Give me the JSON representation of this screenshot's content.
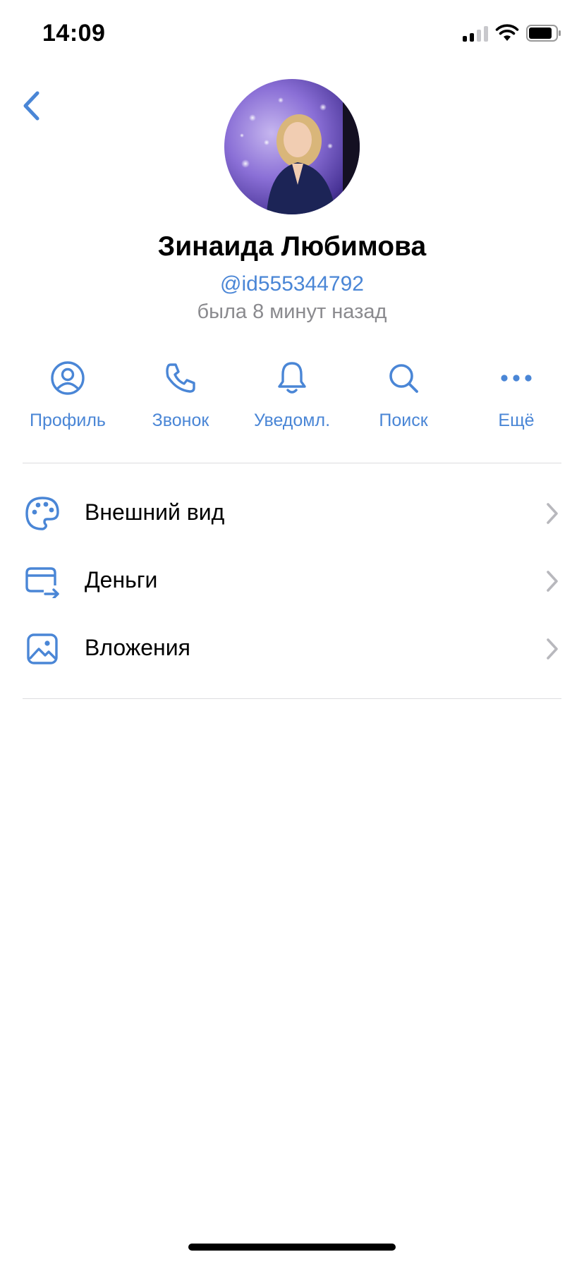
{
  "status_bar": {
    "time": "14:09"
  },
  "profile": {
    "name": "Зинаида Любимова",
    "handle": "@id555344792",
    "last_seen": "была 8 минут назад"
  },
  "actions": [
    {
      "label": "Профиль",
      "icon": "profile-icon"
    },
    {
      "label": "Звонок",
      "icon": "phone-icon"
    },
    {
      "label": "Уведомл.",
      "icon": "bell-icon"
    },
    {
      "label": "Поиск",
      "icon": "search-icon"
    },
    {
      "label": "Ещё",
      "icon": "more-icon"
    }
  ],
  "menu": [
    {
      "label": "Внешний вид",
      "icon": "palette-icon"
    },
    {
      "label": "Деньги",
      "icon": "card-transfer-icon"
    },
    {
      "label": "Вложения",
      "icon": "image-icon"
    }
  ],
  "colors": {
    "accent": "#4a86d6",
    "secondary_text": "#8a8a8e",
    "divider": "#dcdcdf",
    "chevron": "#b8b8bd"
  }
}
